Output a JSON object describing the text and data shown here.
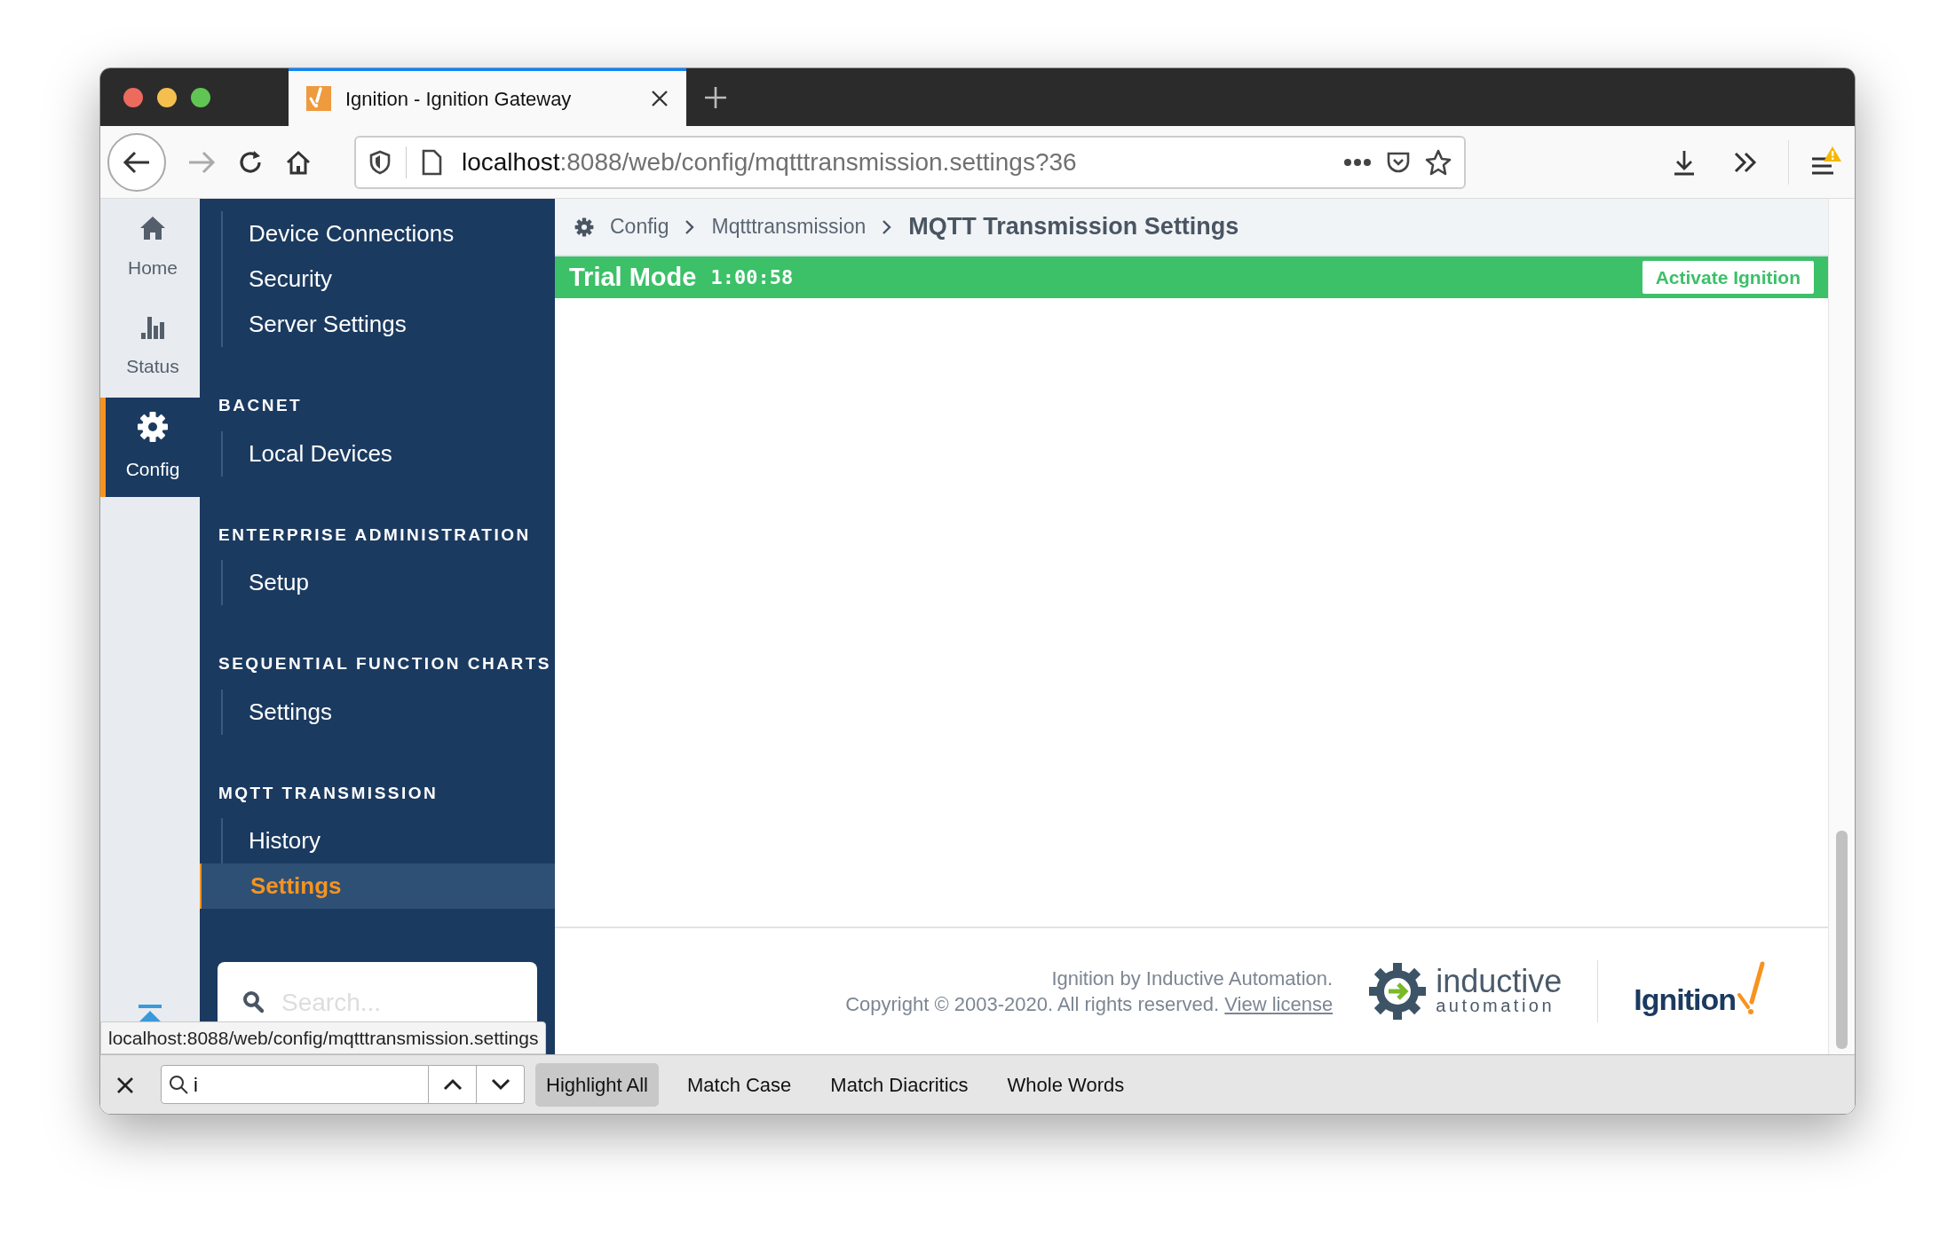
{
  "browser": {
    "tab_title": "Ignition - Ignition Gateway",
    "url_host": "localhost",
    "url_rest": ":8088/web/config/mqtttransmission.settings?36",
    "status_url": "localhost:8088/web/config/mqtttransmission.settings"
  },
  "rail": [
    {
      "kind": "home",
      "label": "Home",
      "selected": false
    },
    {
      "kind": "status",
      "label": "Status",
      "selected": false
    },
    {
      "kind": "config",
      "label": "Config",
      "selected": true
    }
  ],
  "sidebar": [
    {
      "items": [
        {
          "label": "Device Connections",
          "selected": false
        },
        {
          "label": "Security",
          "selected": false
        },
        {
          "label": "Server Settings",
          "selected": false
        }
      ]
    },
    {
      "heading": "BACNET",
      "items": [
        {
          "label": "Local Devices",
          "selected": false
        }
      ]
    },
    {
      "heading": "ENTERPRISE ADMINISTRATION",
      "items": [
        {
          "label": "Setup",
          "selected": false
        }
      ]
    },
    {
      "heading": "SEQUENTIAL FUNCTION CHARTS",
      "items": [
        {
          "label": "Settings",
          "selected": false
        }
      ]
    },
    {
      "heading": "MQTT TRANSMISSION",
      "items": [
        {
          "label": "History",
          "selected": false
        },
        {
          "label": "Settings",
          "selected": true
        }
      ]
    }
  ],
  "search": {
    "placeholder": "Search..."
  },
  "breadcrumb": [
    "Config",
    "Mqtttransmission"
  ],
  "page_title": "MQTT Transmission Settings",
  "trial": {
    "label": "Trial Mode",
    "time": "1:00:58",
    "button": "Activate Ignition"
  },
  "footer": {
    "line1": "Ignition by Inductive Automation.",
    "line2": "Copyright © 2003-2020. All rights reserved.",
    "link": "View license",
    "logo1_top": "inductive",
    "logo1_bottom": "automation",
    "logo2": "Ignition"
  },
  "find_bar": {
    "value": "i",
    "options": [
      {
        "label": "Highlight All",
        "selected": true
      },
      {
        "label": "Match Case",
        "selected": false
      },
      {
        "label": "Match Diacritics",
        "selected": false
      },
      {
        "label": "Whole Words",
        "selected": false
      }
    ]
  }
}
